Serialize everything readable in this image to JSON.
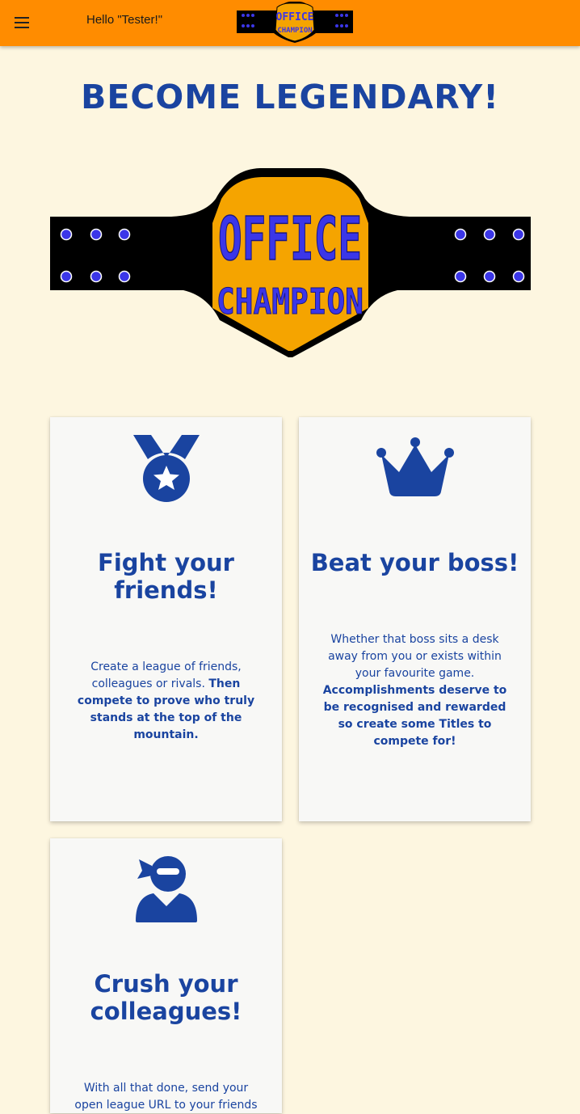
{
  "header": {
    "greeting": "Hello \"Tester!\"",
    "menu_icon": "hamburger-menu-icon",
    "brand_lines": [
      "OFFICE",
      "CHAMPION"
    ]
  },
  "hero": {
    "headline": "BECOME LEGENDARY!",
    "brand_lines": [
      "OFFICE",
      "CHAMPION"
    ]
  },
  "colors": {
    "topbar": "#ff8c00",
    "background": "#fdf6e0",
    "brand_blue": "#1a44a0",
    "belt_black": "#000000",
    "belt_gold": "#f5a400",
    "belt_purple": "#3b36e8"
  },
  "cards": [
    {
      "icon": "medal-icon",
      "title": "Fight your friends!",
      "text_plain": "Create a league of friends, colleagues or rivals.",
      "text_bold": "Then compete to prove who truly stands at the top of the mountain."
    },
    {
      "icon": "crown-icon",
      "title": "Beat your boss!",
      "text_plain": "Whether that boss sits a desk away from you or exists within your favourite game.",
      "text_bold": "Accomplishments deserve to be recognised and rewarded so create some Titles to compete for!"
    },
    {
      "icon": "ninja-icon",
      "title": "Crush your colleagues!",
      "text_plain": "With all that done, send your open league URL to your friends",
      "text_bold": ""
    }
  ]
}
